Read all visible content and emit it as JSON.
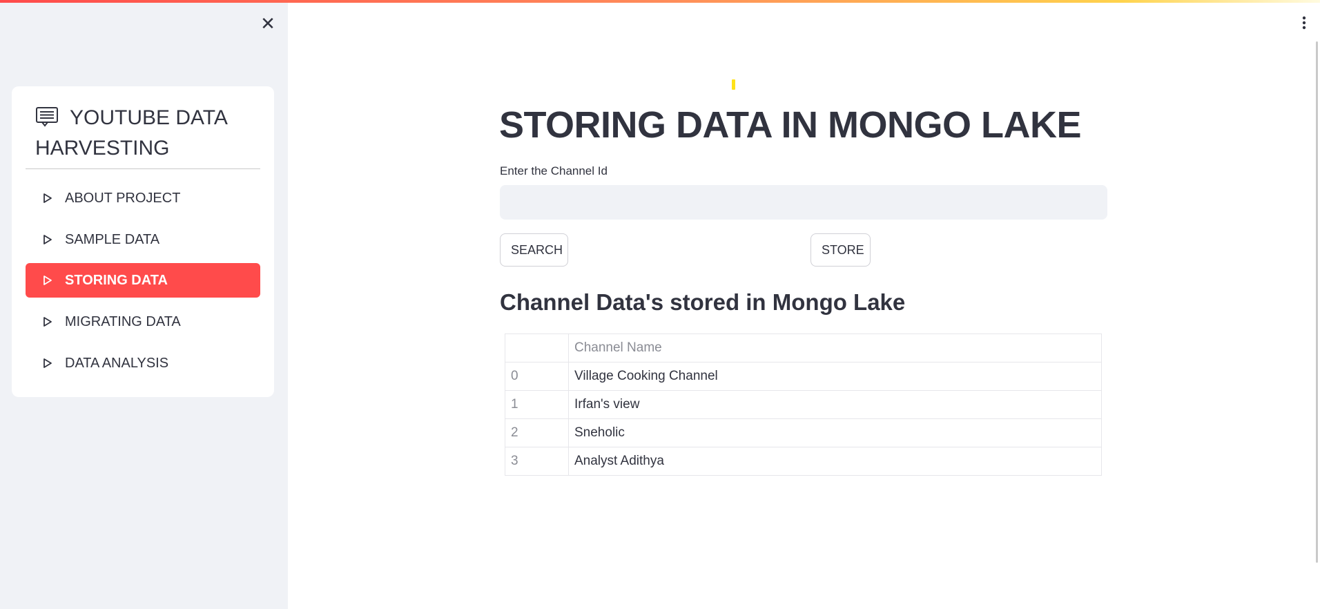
{
  "sidebar": {
    "title": "YOUTUBE DATA HARVESTING",
    "items": [
      {
        "label": "ABOUT PROJECT",
        "active": false
      },
      {
        "label": "SAMPLE DATA",
        "active": false
      },
      {
        "label": "STORING DATA",
        "active": true
      },
      {
        "label": "MIGRATING DATA",
        "active": false
      },
      {
        "label": "DATA ANALYSIS",
        "active": false
      }
    ],
    "icons": {
      "close": "close-icon",
      "title": "list-icon",
      "item": "play-triangle-icon"
    }
  },
  "main": {
    "title": "STORING DATA IN MONGO LAKE",
    "input_label": "Enter the Channel Id",
    "input_value": "",
    "search_label": "SEARCH",
    "store_label": "STORE",
    "subheading": "Channel Data's stored in Mongo Lake",
    "table": {
      "columns": [
        "",
        "Channel Name"
      ],
      "rows": [
        [
          "0",
          "Village Cooking Channel"
        ],
        [
          "1",
          "Irfan's view"
        ],
        [
          "2",
          "Sneholic"
        ],
        [
          "3",
          "Analyst Adithya"
        ]
      ]
    }
  },
  "colors": {
    "accent": "#ff4b4b",
    "sidebar_bg": "#f0f2f6",
    "text": "#31333f"
  }
}
